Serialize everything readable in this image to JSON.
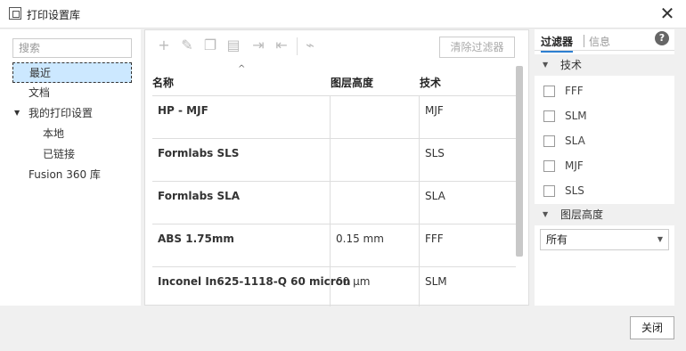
{
  "window": {
    "title": "打印设置库",
    "close_glyph": "✕",
    "icon": "library-icon"
  },
  "left": {
    "search_placeholder": "搜索",
    "nav": [
      {
        "label": "最近",
        "selected": true
      },
      {
        "label": "文档"
      },
      {
        "label": "我的打印设置",
        "expandable": true
      },
      {
        "label": "本地",
        "indent": 1
      },
      {
        "label": "已链接",
        "indent": 1
      },
      {
        "label": "Fusion 360 库"
      }
    ]
  },
  "toolbar": {
    "icons": [
      "add-icon",
      "edit-icon",
      "copy-icon",
      "paste-icon",
      "import-icon",
      "export-icon",
      "clean-icon"
    ],
    "clear_filters": "清除过滤器"
  },
  "table": {
    "headers": {
      "name": "名称",
      "layer": "图层高度",
      "tech": "技术"
    },
    "rows": [
      {
        "name": "HP - MJF",
        "layer": "",
        "tech": "MJF"
      },
      {
        "name": "Formlabs SLS",
        "layer": "",
        "tech": "SLS"
      },
      {
        "name": "Formlabs SLA",
        "layer": "",
        "tech": "SLA"
      },
      {
        "name": "ABS 1.75mm",
        "layer": "0.15 mm",
        "tech": "FFF"
      },
      {
        "name": "Inconel In625-1118-Q 60 micron",
        "layer": "60 μm",
        "tech": "SLM"
      }
    ]
  },
  "right": {
    "tabs": {
      "filter": "过滤器",
      "info": "信息"
    },
    "help": "?",
    "tech_section": "技术",
    "tech_options": [
      "FFF",
      "SLM",
      "SLA",
      "MJF",
      "SLS"
    ],
    "layer_section": "图层高度",
    "layer_select_value": "所有"
  },
  "footer": {
    "close": "关闭"
  }
}
